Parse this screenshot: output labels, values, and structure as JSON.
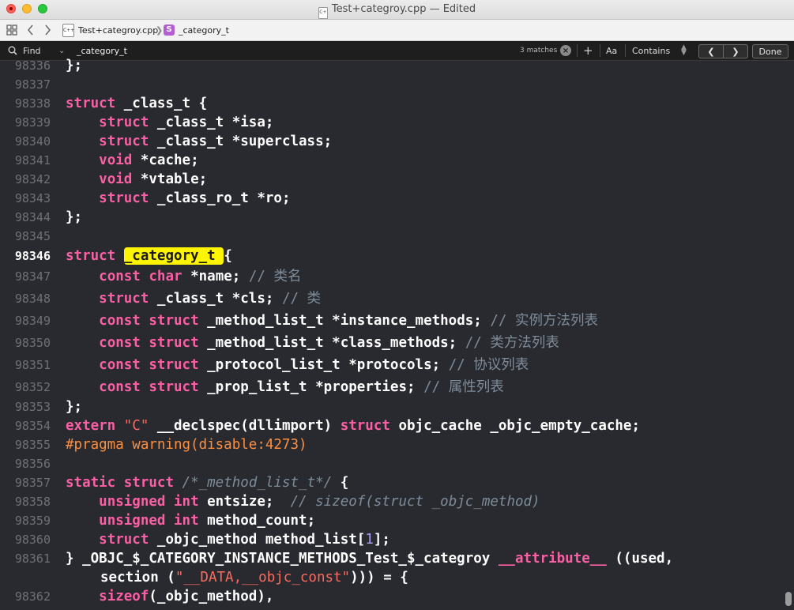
{
  "window": {
    "title": "Test+categroy.cpp — Edited",
    "file_icon": "cpp-file-icon"
  },
  "jumpbar": {
    "grid_icon": "related-items-grid-icon",
    "back_icon": "chevron-left-icon",
    "forward_icon": "chevron-right-icon",
    "file_badge": "C++",
    "file_label": "Test+categroy.cpp",
    "separator": "❯",
    "symbol_badge": "S",
    "symbol_label": "_category_t"
  },
  "findbar": {
    "search_icon": "magnifier-icon",
    "mode_label": "Find",
    "query": "_category_t",
    "match_count": "3 matches",
    "clear_icon": "×",
    "add_icon": "+",
    "case_label": "Aa",
    "match_style": "Contains",
    "prev_icon": "❮",
    "next_icon": "❯",
    "done_label": "Done"
  },
  "colors": {
    "keyword": "#fc5fa3",
    "comment": "#7f8c98",
    "preprocessor": "#fd8f3f",
    "string": "#fc6a5d",
    "number": "#a79df0",
    "highlight": "#fff500",
    "background": "#292a30"
  },
  "editor": {
    "current_line": "98346",
    "lines": [
      {
        "num": "98336",
        "tokens": [
          [
            "",
            "};"
          ]
        ]
      },
      {
        "num": "98337",
        "tokens": []
      },
      {
        "num": "98338",
        "tokens": [
          [
            "kw",
            "struct"
          ],
          [
            "",
            " _class_t {"
          ]
        ]
      },
      {
        "num": "98339",
        "tokens": [
          [
            "",
            "    "
          ],
          [
            "kw",
            "struct"
          ],
          [
            "",
            " _class_t *isa;"
          ]
        ]
      },
      {
        "num": "98340",
        "tokens": [
          [
            "",
            "    "
          ],
          [
            "kw",
            "struct"
          ],
          [
            "",
            " _class_t *superclass;"
          ]
        ]
      },
      {
        "num": "98341",
        "tokens": [
          [
            "",
            "    "
          ],
          [
            "kw",
            "void"
          ],
          [
            "",
            " *cache;"
          ]
        ]
      },
      {
        "num": "98342",
        "tokens": [
          [
            "",
            "    "
          ],
          [
            "kw",
            "void"
          ],
          [
            "",
            " *vtable;"
          ]
        ]
      },
      {
        "num": "98343",
        "tokens": [
          [
            "",
            "    "
          ],
          [
            "kw",
            "struct"
          ],
          [
            "",
            " _class_ro_t *ro;"
          ]
        ]
      },
      {
        "num": "98344",
        "tokens": [
          [
            "",
            "};"
          ]
        ]
      },
      {
        "num": "98345",
        "tokens": []
      },
      {
        "num": "98346",
        "tokens": [
          [
            "kw",
            "struct"
          ],
          [
            "",
            " "
          ],
          [
            "hl",
            "_category_t "
          ],
          [
            "",
            "{"
          ]
        ]
      },
      {
        "num": "98347",
        "tokens": [
          [
            "",
            "    "
          ],
          [
            "kw",
            "const"
          ],
          [
            "",
            " "
          ],
          [
            "kw",
            "char"
          ],
          [
            "",
            " *name; "
          ],
          [
            "cm",
            "// 类名"
          ]
        ]
      },
      {
        "num": "98348",
        "tokens": [
          [
            "",
            "    "
          ],
          [
            "kw",
            "struct"
          ],
          [
            "",
            " _class_t *cls; "
          ],
          [
            "cm",
            "// 类"
          ]
        ]
      },
      {
        "num": "98349",
        "tokens": [
          [
            "",
            "    "
          ],
          [
            "kw",
            "const"
          ],
          [
            "",
            " "
          ],
          [
            "kw",
            "struct"
          ],
          [
            "",
            " _method_list_t *instance_methods; "
          ],
          [
            "cm",
            "// 实例方法列表"
          ]
        ]
      },
      {
        "num": "98350",
        "tokens": [
          [
            "",
            "    "
          ],
          [
            "kw",
            "const"
          ],
          [
            "",
            " "
          ],
          [
            "kw",
            "struct"
          ],
          [
            "",
            " _method_list_t *class_methods; "
          ],
          [
            "cm",
            "// 类方法列表"
          ]
        ]
      },
      {
        "num": "98351",
        "tokens": [
          [
            "",
            "    "
          ],
          [
            "kw",
            "const"
          ],
          [
            "",
            " "
          ],
          [
            "kw",
            "struct"
          ],
          [
            "",
            " _protocol_list_t *protocols; "
          ],
          [
            "cm",
            "// 协议列表"
          ]
        ]
      },
      {
        "num": "98352",
        "tokens": [
          [
            "",
            "    "
          ],
          [
            "kw",
            "const"
          ],
          [
            "",
            " "
          ],
          [
            "kw",
            "struct"
          ],
          [
            "",
            " _prop_list_t *properties; "
          ],
          [
            "cm",
            "// 属性列表"
          ]
        ]
      },
      {
        "num": "98353",
        "tokens": [
          [
            "",
            "};"
          ]
        ]
      },
      {
        "num": "98354",
        "tokens": [
          [
            "kw",
            "extern"
          ],
          [
            "",
            " "
          ],
          [
            "str",
            "\"C\""
          ],
          [
            "",
            " __declspec(dllimport) "
          ],
          [
            "kw",
            "struct"
          ],
          [
            "",
            " objc_cache _objc_empty_cache;"
          ]
        ]
      },
      {
        "num": "98355",
        "tokens": [
          [
            "pp",
            "#pragma warning(disable:4273)"
          ]
        ]
      },
      {
        "num": "98356",
        "tokens": []
      },
      {
        "num": "98357",
        "tokens": [
          [
            "kw",
            "static"
          ],
          [
            "",
            " "
          ],
          [
            "kw",
            "struct"
          ],
          [
            "",
            " "
          ],
          [
            "cmi",
            "/*_method_list_t*/"
          ],
          [
            "",
            " {"
          ]
        ]
      },
      {
        "num": "98358",
        "tokens": [
          [
            "",
            "    "
          ],
          [
            "kw",
            "unsigned"
          ],
          [
            "",
            " "
          ],
          [
            "kw",
            "int"
          ],
          [
            "",
            " entsize;  "
          ],
          [
            "cmi",
            "// sizeof(struct _objc_method)"
          ]
        ]
      },
      {
        "num": "98359",
        "tokens": [
          [
            "",
            "    "
          ],
          [
            "kw",
            "unsigned"
          ],
          [
            "",
            " "
          ],
          [
            "kw",
            "int"
          ],
          [
            "",
            " method_count;"
          ]
        ]
      },
      {
        "num": "98360",
        "tokens": [
          [
            "",
            "    "
          ],
          [
            "kw",
            "struct"
          ],
          [
            "",
            " _objc_method method_list["
          ],
          [
            "num",
            "1"
          ],
          [
            "",
            "];"
          ]
        ]
      },
      {
        "num": "98361",
        "tokens": [
          [
            "",
            "} _OBJC_$_CATEGORY_INSTANCE_METHODS_Test_$_categroy "
          ],
          [
            "kw",
            "__attribute__"
          ],
          [
            "",
            " ((used,"
          ]
        ]
      },
      {
        "num": "",
        "cont": true,
        "tokens": [
          [
            "",
            "section ("
          ],
          [
            "str",
            "\"__DATA,__objc_const\""
          ],
          [
            "",
            "))) = {"
          ]
        ]
      },
      {
        "num": "98362",
        "tokens": [
          [
            "",
            "    "
          ],
          [
            "kw",
            "sizeof"
          ],
          [
            "",
            "(_objc_method),"
          ]
        ]
      }
    ]
  }
}
